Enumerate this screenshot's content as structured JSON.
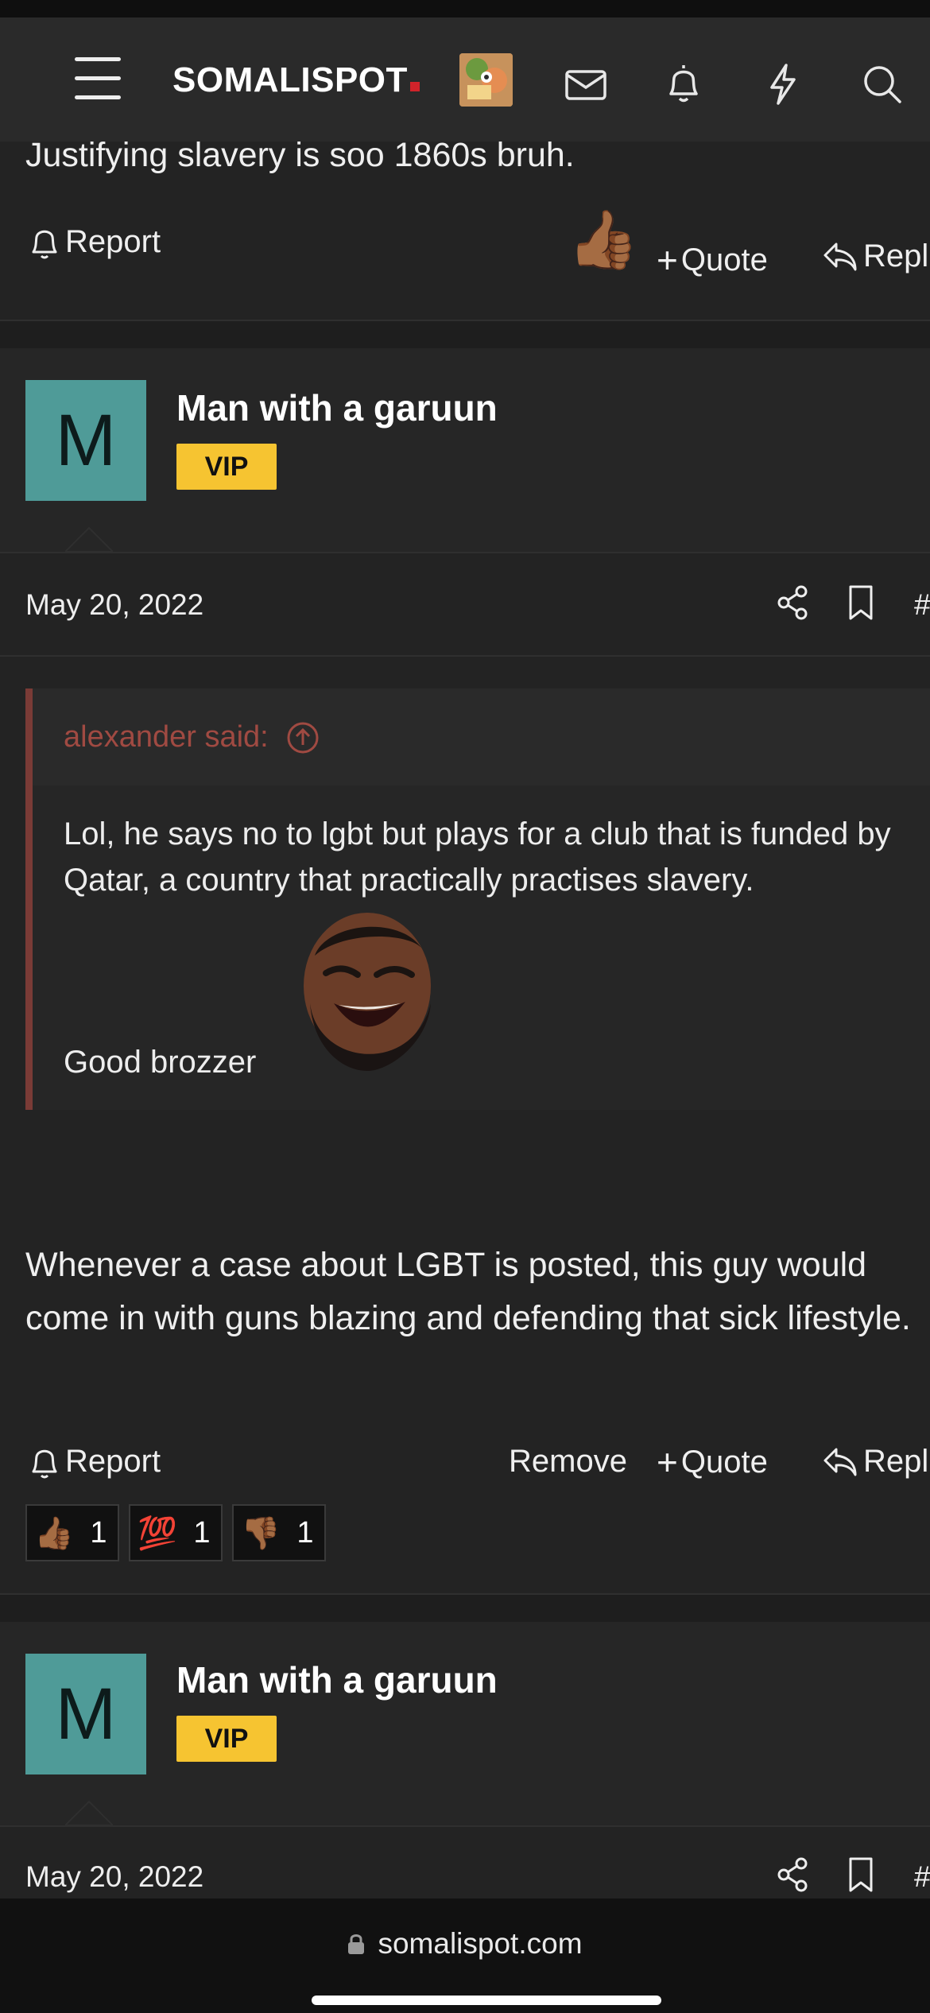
{
  "header": {
    "logo_text": "SOMALISPOT",
    "icons": [
      "menu-icon",
      "avatar",
      "mail-icon",
      "bell-icon",
      "lightning-icon",
      "search-icon"
    ]
  },
  "post_prev": {
    "text_tail": "Justifying slavery is soo 1860s bruh.",
    "report_label": "Report",
    "quote_label": "Quote",
    "reply_label": "Repl"
  },
  "post1": {
    "avatar_letter": "M",
    "username": "Man with a garuun",
    "badge": "VIP",
    "date": "May 20, 2022",
    "post_number_symbol": "#",
    "quote": {
      "author_line": "alexander said:",
      "text": "Lol, he says no to lgbt but plays for a club that is funded by Qatar, a country that practically practises slavery.",
      "footer_text": "Good brozzer"
    },
    "body": "Whenever a case about LGBT is posted, this guy would come in with guns blazing and defending that sick lifestyle.",
    "report_label": "Report",
    "remove_label": "Remove",
    "quote_label": "Quote",
    "reply_label": "Repl",
    "reactions": [
      {
        "emoji": "👍🏾",
        "count": "1"
      },
      {
        "emoji": "💯",
        "count": "1"
      },
      {
        "emoji": "👎🏾",
        "count": "1"
      }
    ]
  },
  "post2": {
    "avatar_letter": "M",
    "username": "Man with a garuun",
    "badge": "VIP",
    "date": "May 20, 2022",
    "post_number_symbol": "#"
  },
  "browser": {
    "url": "somalispot.com"
  },
  "colors": {
    "background": "#232323",
    "header": "#2a2a2a",
    "vip_badge": "#f6c431",
    "avatar": "#4f9b98",
    "quote_accent": "#7a3b36"
  }
}
